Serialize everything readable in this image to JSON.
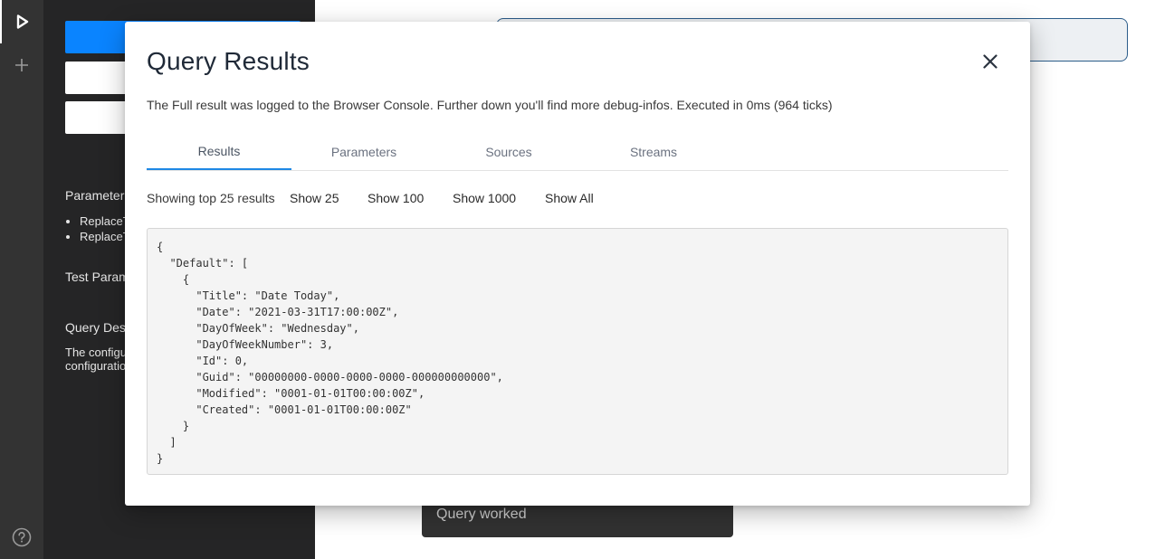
{
  "panel": {
    "parameters_heading": "Parameter",
    "parameter_items": [
      "ReplaceT",
      "ReplaceT"
    ],
    "test_params_heading": "Test Param",
    "query_desc_heading": "Query Desc",
    "query_desc_text": "The configu\nconfiguratio"
  },
  "modal": {
    "title": "Query Results",
    "subtitle": "The Full result was logged to the Browser Console. Further down you'll find more debug-infos. Executed in 0ms (964 ticks)",
    "tabs": [
      {
        "label": "Results",
        "active": true
      },
      {
        "label": "Parameters",
        "active": false
      },
      {
        "label": "Sources",
        "active": false
      },
      {
        "label": "Streams",
        "active": false
      }
    ],
    "showing_text": "Showing top 25 results",
    "show_buttons": [
      "Show 25",
      "Show 100",
      "Show 1000",
      "Show All"
    ],
    "result_json": "{\n  \"Default\": [\n    {\n      \"Title\": \"Date Today\",\n      \"Date\": \"2021-03-31T17:00:00Z\",\n      \"DayOfWeek\": \"Wednesday\",\n      \"DayOfWeekNumber\": 3,\n      \"Id\": 0,\n      \"Guid\": \"00000000-0000-0000-0000-000000000000\",\n      \"Modified\": \"0001-01-01T00:00:00Z\",\n      \"Created\": \"0001-01-01T00:00:00Z\"\n    }\n  ]\n}"
  },
  "toast": {
    "message": "Query worked"
  },
  "icons": {
    "run": "play-icon",
    "add": "plus-icon",
    "help": "help-circle-icon",
    "close": "close-icon"
  },
  "colors": {
    "primary": "#0a84ff",
    "tab_indicator": "#1e88e5",
    "rail_bg": "#333333",
    "panel_bg": "#252526"
  }
}
